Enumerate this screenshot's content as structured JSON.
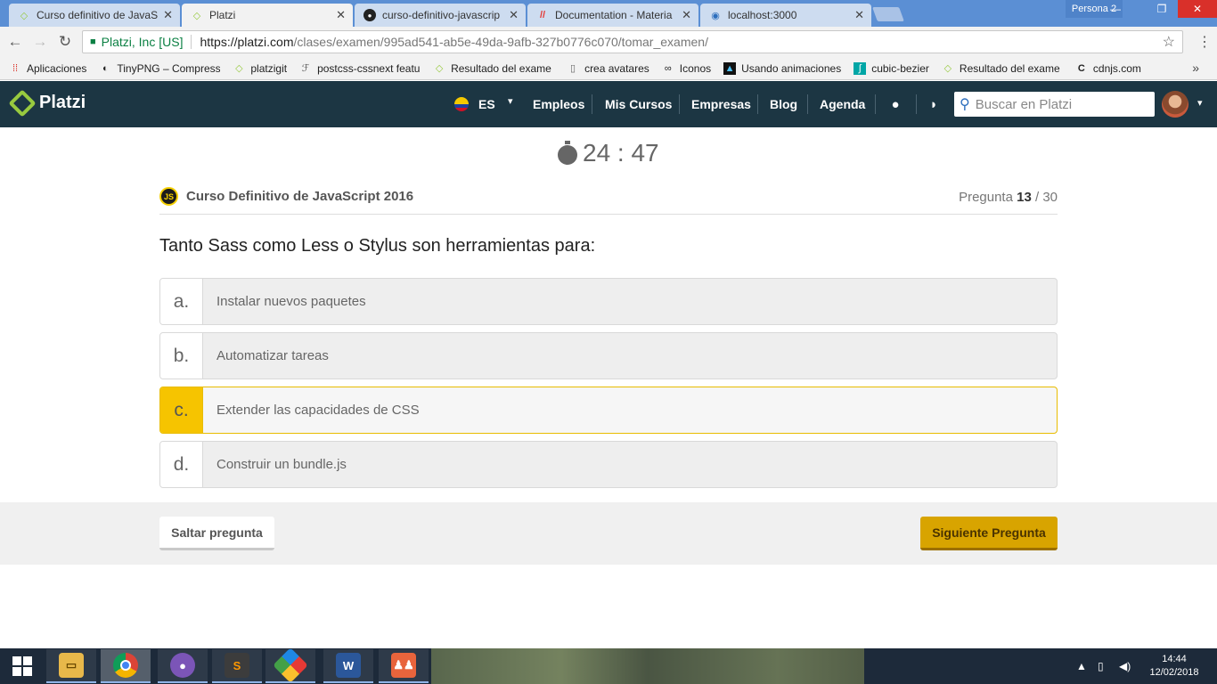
{
  "browser": {
    "tabs": [
      {
        "title": "Curso definitivo de JavaS",
        "icon": "platzi-icon"
      },
      {
        "title": "Platzi",
        "icon": "platzi-icon"
      },
      {
        "title": "curso-definitivo-javascrip",
        "icon": "github-icon"
      },
      {
        "title": "Documentation - Materia",
        "icon": "materialize-icon"
      },
      {
        "title": "localhost:3000",
        "icon": "globe-icon"
      }
    ],
    "active_tab": 1,
    "profile": "Persona 2",
    "secure_label": "Platzi, Inc [US]",
    "url_scheme_host": "https://platzi.com",
    "url_path": "/clases/examen/995ad541-ab5e-49da-9afb-327b0776c070/tomar_examen/",
    "bookmarks": [
      {
        "label": "Aplicaciones",
        "icon": "apps-icon"
      },
      {
        "label": "TinyPNG – Compress",
        "icon": "panda-icon"
      },
      {
        "label": "platzigit",
        "icon": "platzi-icon"
      },
      {
        "label": "postcss-cssnext featu",
        "icon": "postcss-icon"
      },
      {
        "label": "Resultado del exame",
        "icon": "platzi-icon"
      },
      {
        "label": "crea avatares",
        "icon": "page-icon"
      },
      {
        "label": "Iconos",
        "icon": "glasses-icon"
      },
      {
        "label": "Usando animaciones",
        "icon": "cap-icon"
      },
      {
        "label": "cubic-bezier",
        "icon": "curve-icon"
      },
      {
        "label": "Resultado del exame",
        "icon": "platzi-icon"
      },
      {
        "label": "cdnjs.com",
        "icon": "cdnjs-icon"
      }
    ]
  },
  "header": {
    "logo": "Platzi",
    "lang": "ES",
    "nav": [
      "Empleos",
      "Mis Cursos",
      "Empresas",
      "Blog",
      "Agenda"
    ],
    "search_placeholder": "Buscar en Platzi"
  },
  "exam": {
    "timer": "24 : 47",
    "course_badge": "JS",
    "course": "Curso Definitivo de JavaScript 2016",
    "question_label": "Pregunta",
    "question_current": "13",
    "question_total": " / 30",
    "question": "Tanto Sass como Less o Stylus son herramientas para:",
    "options": [
      {
        "letter": "a.",
        "text": "Instalar nuevos paquetes",
        "selected": false
      },
      {
        "letter": "b.",
        "text": "Automatizar tareas",
        "selected": false
      },
      {
        "letter": "c.",
        "text": "Extender las capacidades de CSS",
        "selected": true
      },
      {
        "letter": "d.",
        "text": "Construir un bundle.js",
        "selected": false
      }
    ],
    "skip_label": "Saltar pregunta",
    "next_label": "Siguiente Pregunta"
  },
  "taskbar": {
    "apps": [
      "file-explorer-icon",
      "chrome-icon",
      "github-desktop-icon",
      "sublime-text-icon",
      "gitkraken-icon",
      "word-icon",
      "people-icon"
    ],
    "active_app": "chrome-icon",
    "time": "14:44",
    "date": "12/02/2018"
  },
  "colors": {
    "platzi_header": "#1c3643",
    "platzi_green": "#98ca3f",
    "selected_option": "#f6c400",
    "next_button": "#d8a400"
  }
}
